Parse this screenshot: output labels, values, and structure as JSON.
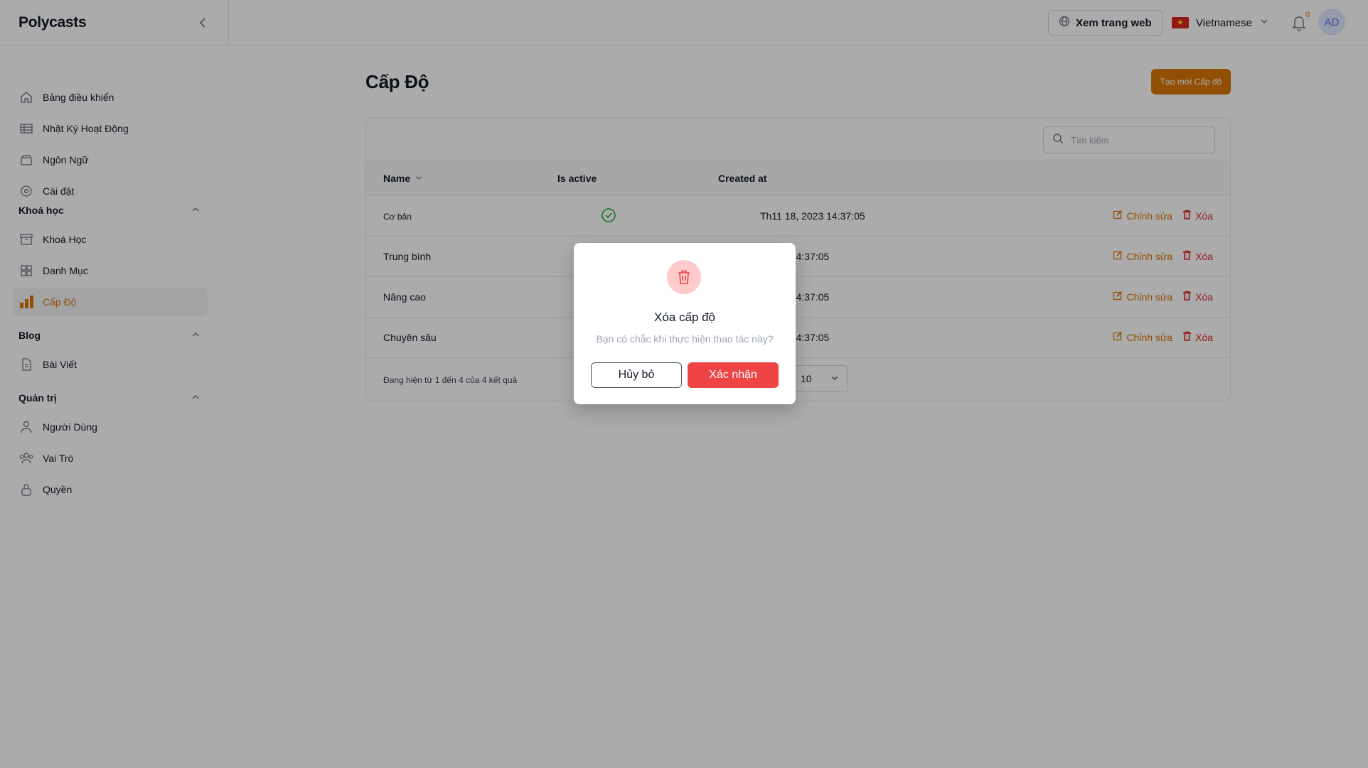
{
  "app": {
    "brand": "Polycasts"
  },
  "header": {
    "view_site": "Xem trang web",
    "language": "Vietnamese",
    "notification_count": "0",
    "avatar_initials": "AD"
  },
  "sidebar": {
    "items": [
      {
        "label": "Bảng điều khiển",
        "icon": "home-icon"
      },
      {
        "label": "Nhật Ký Hoạt Động",
        "icon": "table-icon"
      },
      {
        "label": "Ngôn Ngữ",
        "icon": "archive-icon"
      },
      {
        "label": "Cài đặt",
        "icon": "settings-icon"
      }
    ],
    "sections": [
      {
        "title": "Khoá học",
        "items": [
          {
            "label": "Khoá Học",
            "icon": "archive-icon"
          },
          {
            "label": "Danh Mục",
            "icon": "grid-icon"
          },
          {
            "label": "Cấp Độ",
            "icon": "chart-bar-icon",
            "active": true
          }
        ]
      },
      {
        "title": "Blog",
        "items": [
          {
            "label": "Bài Viết",
            "icon": "document-icon"
          }
        ]
      },
      {
        "title": "Quản trị",
        "items": [
          {
            "label": "Người Dùng",
            "icon": "user-icon"
          },
          {
            "label": "Vai Trò",
            "icon": "users-icon"
          },
          {
            "label": "Quyền",
            "icon": "lock-icon"
          }
        ]
      }
    ]
  },
  "main": {
    "title": "Cấp Độ",
    "create_button": "Tạo mới Cấp độ",
    "search_placeholder": "Tìm kiếm",
    "columns": {
      "name": "Name",
      "is_active": "Is active",
      "created_at": "Created at"
    },
    "rows": [
      {
        "name": "Cơ bản",
        "created_at": "Th11 18, 2023 14:37:05"
      },
      {
        "name": "Trung bình",
        "created_at": ", 2023 14:37:05"
      },
      {
        "name": "Nâng cao",
        "created_at": ", 2023 14:37:05"
      },
      {
        "name": "Chuyên sâu",
        "created_at": ", 2023 14:37:05"
      }
    ],
    "edit_label": "Chỉnh sửa",
    "delete_label": "Xóa",
    "pagination_text": "Đang hiện từ 1 đến 4 của 4 kết quả",
    "per_page": "10"
  },
  "modal": {
    "title": "Xóa cấp độ",
    "description": "Bạn có chắc khi thực hiện thao tác này?",
    "cancel": "Hủy bỏ",
    "confirm": "Xác nhận"
  },
  "colors": {
    "accent": "#d97706",
    "danger": "#ef4444",
    "active_check": "#16a34a"
  }
}
